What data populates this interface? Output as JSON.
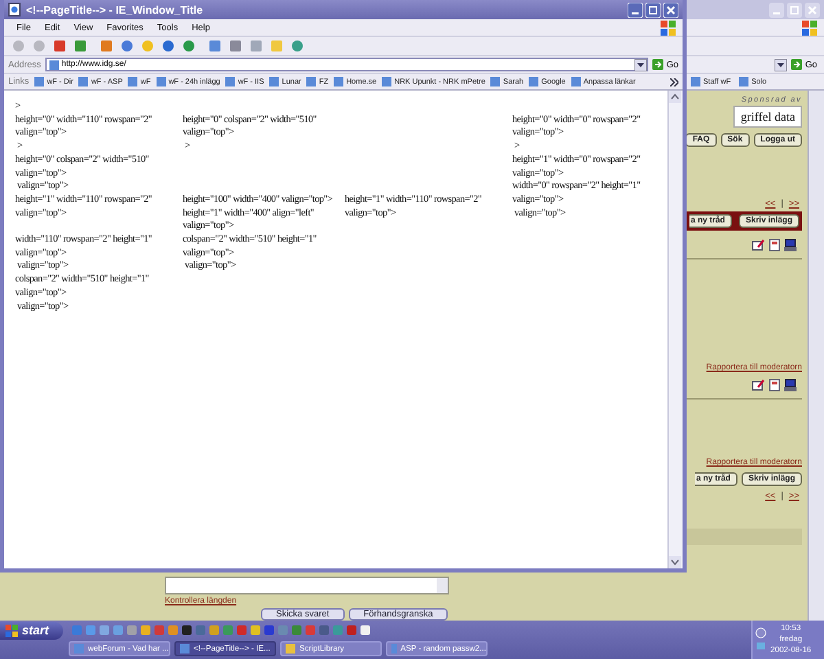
{
  "background_window": {
    "links": [
      "Staff wF",
      "Solo"
    ],
    "go_label": "Go",
    "sponsor_label": "Sponsrad av",
    "sponsor_name": "griffel data",
    "top_buttons": [
      "FAQ",
      "Sök",
      "Logga ut"
    ],
    "pager_top": {
      "prev": "<<",
      "sep": "|",
      "next": ">>"
    },
    "thread_buttons_top": [
      "a ny tråd",
      "Skriv inlägg"
    ],
    "report_links": [
      "Rapportera till moderatorn",
      "Rapportera till moderatorn"
    ],
    "thread_buttons_bottom": [
      "a ny tråd",
      "Skriv inlägg"
    ],
    "pager_bottom": {
      "prev": "<<",
      "sep": "|",
      "next": ">>"
    },
    "check_length_link": "Kontrollera längden",
    "form_buttons": [
      "Skicka svaret",
      "Förhandsgranska"
    ]
  },
  "front_window": {
    "title": "<!--PageTitle--> - IE_Window_Title",
    "menu": [
      "File",
      "Edit",
      "View",
      "Favorites",
      "Tools",
      "Help"
    ],
    "address_label": "Address",
    "address": "http://www.idg.se/",
    "go_label": "Go",
    "links_label": "Links",
    "links": [
      "wF - Dir",
      "wF - ASP",
      "wF",
      "wF - 24h inlägg",
      "wF - IIS",
      "Lunar",
      "FZ",
      "Home.se",
      "NRK Upunkt - NRK mPetre",
      "Sarah",
      "Google",
      "Anpassa länkar"
    ],
    "content_rows": [
      {
        "column_1": [
          ">"
        ]
      },
      {
        "column_1": [
          "height=\"0\" width=\"110\" rowspan=\"2\"",
          "valign=\"top\">"
        ],
        "column_2": [
          "height=\"0\" colspan=\"2\" width=\"510\"",
          "valign=\"top\">"
        ],
        "column_4": [
          "height=\"0\" width=\"0\" rowspan=\"2\"",
          "valign=\"top\">"
        ]
      },
      {
        "column_1": [
          " >"
        ],
        "column_2": [
          " >"
        ],
        "column_4": [
          " >"
        ]
      },
      {
        "column_1": [
          "height=\"0\" colspan=\"2\" width=\"510\"",
          "valign=\"top\">",
          " valign=\"top\">"
        ],
        "column_4": [
          "height=\"1\" width=\"0\" rowspan=\"2\"",
          "valign=\"top\">",
          "width=\"0\" rowspan=\"2\" height=\"1\""
        ]
      },
      {
        "column_1": [
          "height=\"1\" width=\"110\" rowspan=\"2\"",
          "valign=\"top\">"
        ],
        "column_2": [
          "height=\"100\" width=\"400\" valign=\"top\">",
          "height=\"1\" width=\"400\" align=\"left\"",
          "valign=\"top\">"
        ],
        "column_3": [
          "height=\"1\" width=\"110\" rowspan=\"2\"",
          "valign=\"top\">"
        ],
        "column_4": [
          "valign=\"top\">",
          " valign=\"top\">"
        ]
      },
      {
        "column_1": [
          "width=\"110\" rowspan=\"2\" height=\"1\"",
          "valign=\"top\">",
          " valign=\"top\">",
          "colspan=\"2\" width=\"510\" height=\"1\"",
          "valign=\"top\">",
          " valign=\"top\">"
        ],
        "column_2": [
          "colspan=\"2\" width=\"510\" height=\"1\"",
          "valign=\"top\">",
          " valign=\"top\">"
        ]
      }
    ]
  },
  "taskbar": {
    "start": "start",
    "tasks": [
      {
        "label": "webForum - Vad har ...",
        "selected": false
      },
      {
        "label": "<!--PageTitle--> - IE...",
        "selected": true
      },
      {
        "label": "ScriptLibrary",
        "selected": false
      },
      {
        "label": "ASP - random passw2...",
        "selected": false
      }
    ],
    "clock": {
      "time": "10:53",
      "day": "fredag",
      "date": "2002-08-16"
    }
  }
}
